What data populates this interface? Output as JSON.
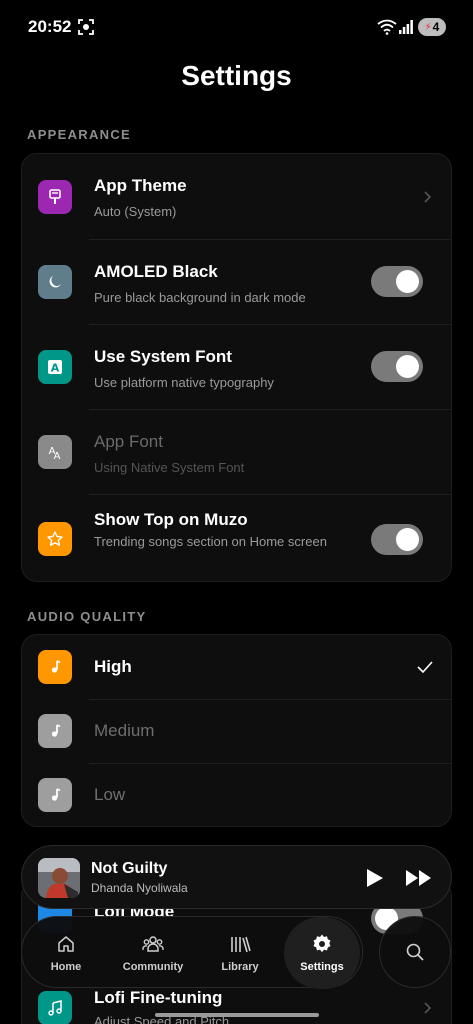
{
  "status": {
    "time": "20:52",
    "battery": "4"
  },
  "page": {
    "title": "Settings"
  },
  "appearance": {
    "section_label": "APPEARANCE",
    "rows": [
      {
        "title": "App Theme",
        "subtitle": "Auto (System)",
        "icon": "brush-icon",
        "color": "#9c27b0"
      },
      {
        "title": "AMOLED Black",
        "subtitle": "Pure black background in dark mode",
        "icon": "moon-icon",
        "color": "#607d8b",
        "toggle": true
      },
      {
        "title": "Use System Font",
        "subtitle": "Use platform native typography",
        "icon": "font-a-icon",
        "color": "#009688",
        "toggle": true
      },
      {
        "title": "App Font",
        "subtitle": "Using Native System Font",
        "icon": "text-aa-icon",
        "color": "#8a8a8a",
        "disabled": true
      },
      {
        "title": "Show Top on Muzo",
        "subtitle": "Trending songs section on Home screen",
        "icon": "star-icon",
        "color": "#ff9800",
        "toggle": true
      }
    ]
  },
  "audio_quality": {
    "section_label": "AUDIO QUALITY",
    "options": [
      {
        "label": "High",
        "selected": true,
        "color": "#ff9800"
      },
      {
        "label": "Medium",
        "selected": false,
        "color": "#9e9e9e"
      },
      {
        "label": "Low",
        "selected": false,
        "color": "#9e9e9e"
      }
    ]
  },
  "hidden_rows": {
    "lofi_mode": "Lofi Mode",
    "lofi_fine_tuning": "Lofi Fine-tuning",
    "lofi_fine_tuning_sub": "Adjust Speed and Pitch"
  },
  "player": {
    "title": "Not Guilty",
    "artist": "Dhanda Nyoliwala"
  },
  "nav": {
    "items": [
      {
        "label": "Home",
        "icon": "home-icon"
      },
      {
        "label": "Community",
        "icon": "community-icon"
      },
      {
        "label": "Library",
        "icon": "library-icon"
      },
      {
        "label": "Settings",
        "icon": "gear-icon",
        "active": true
      }
    ]
  }
}
